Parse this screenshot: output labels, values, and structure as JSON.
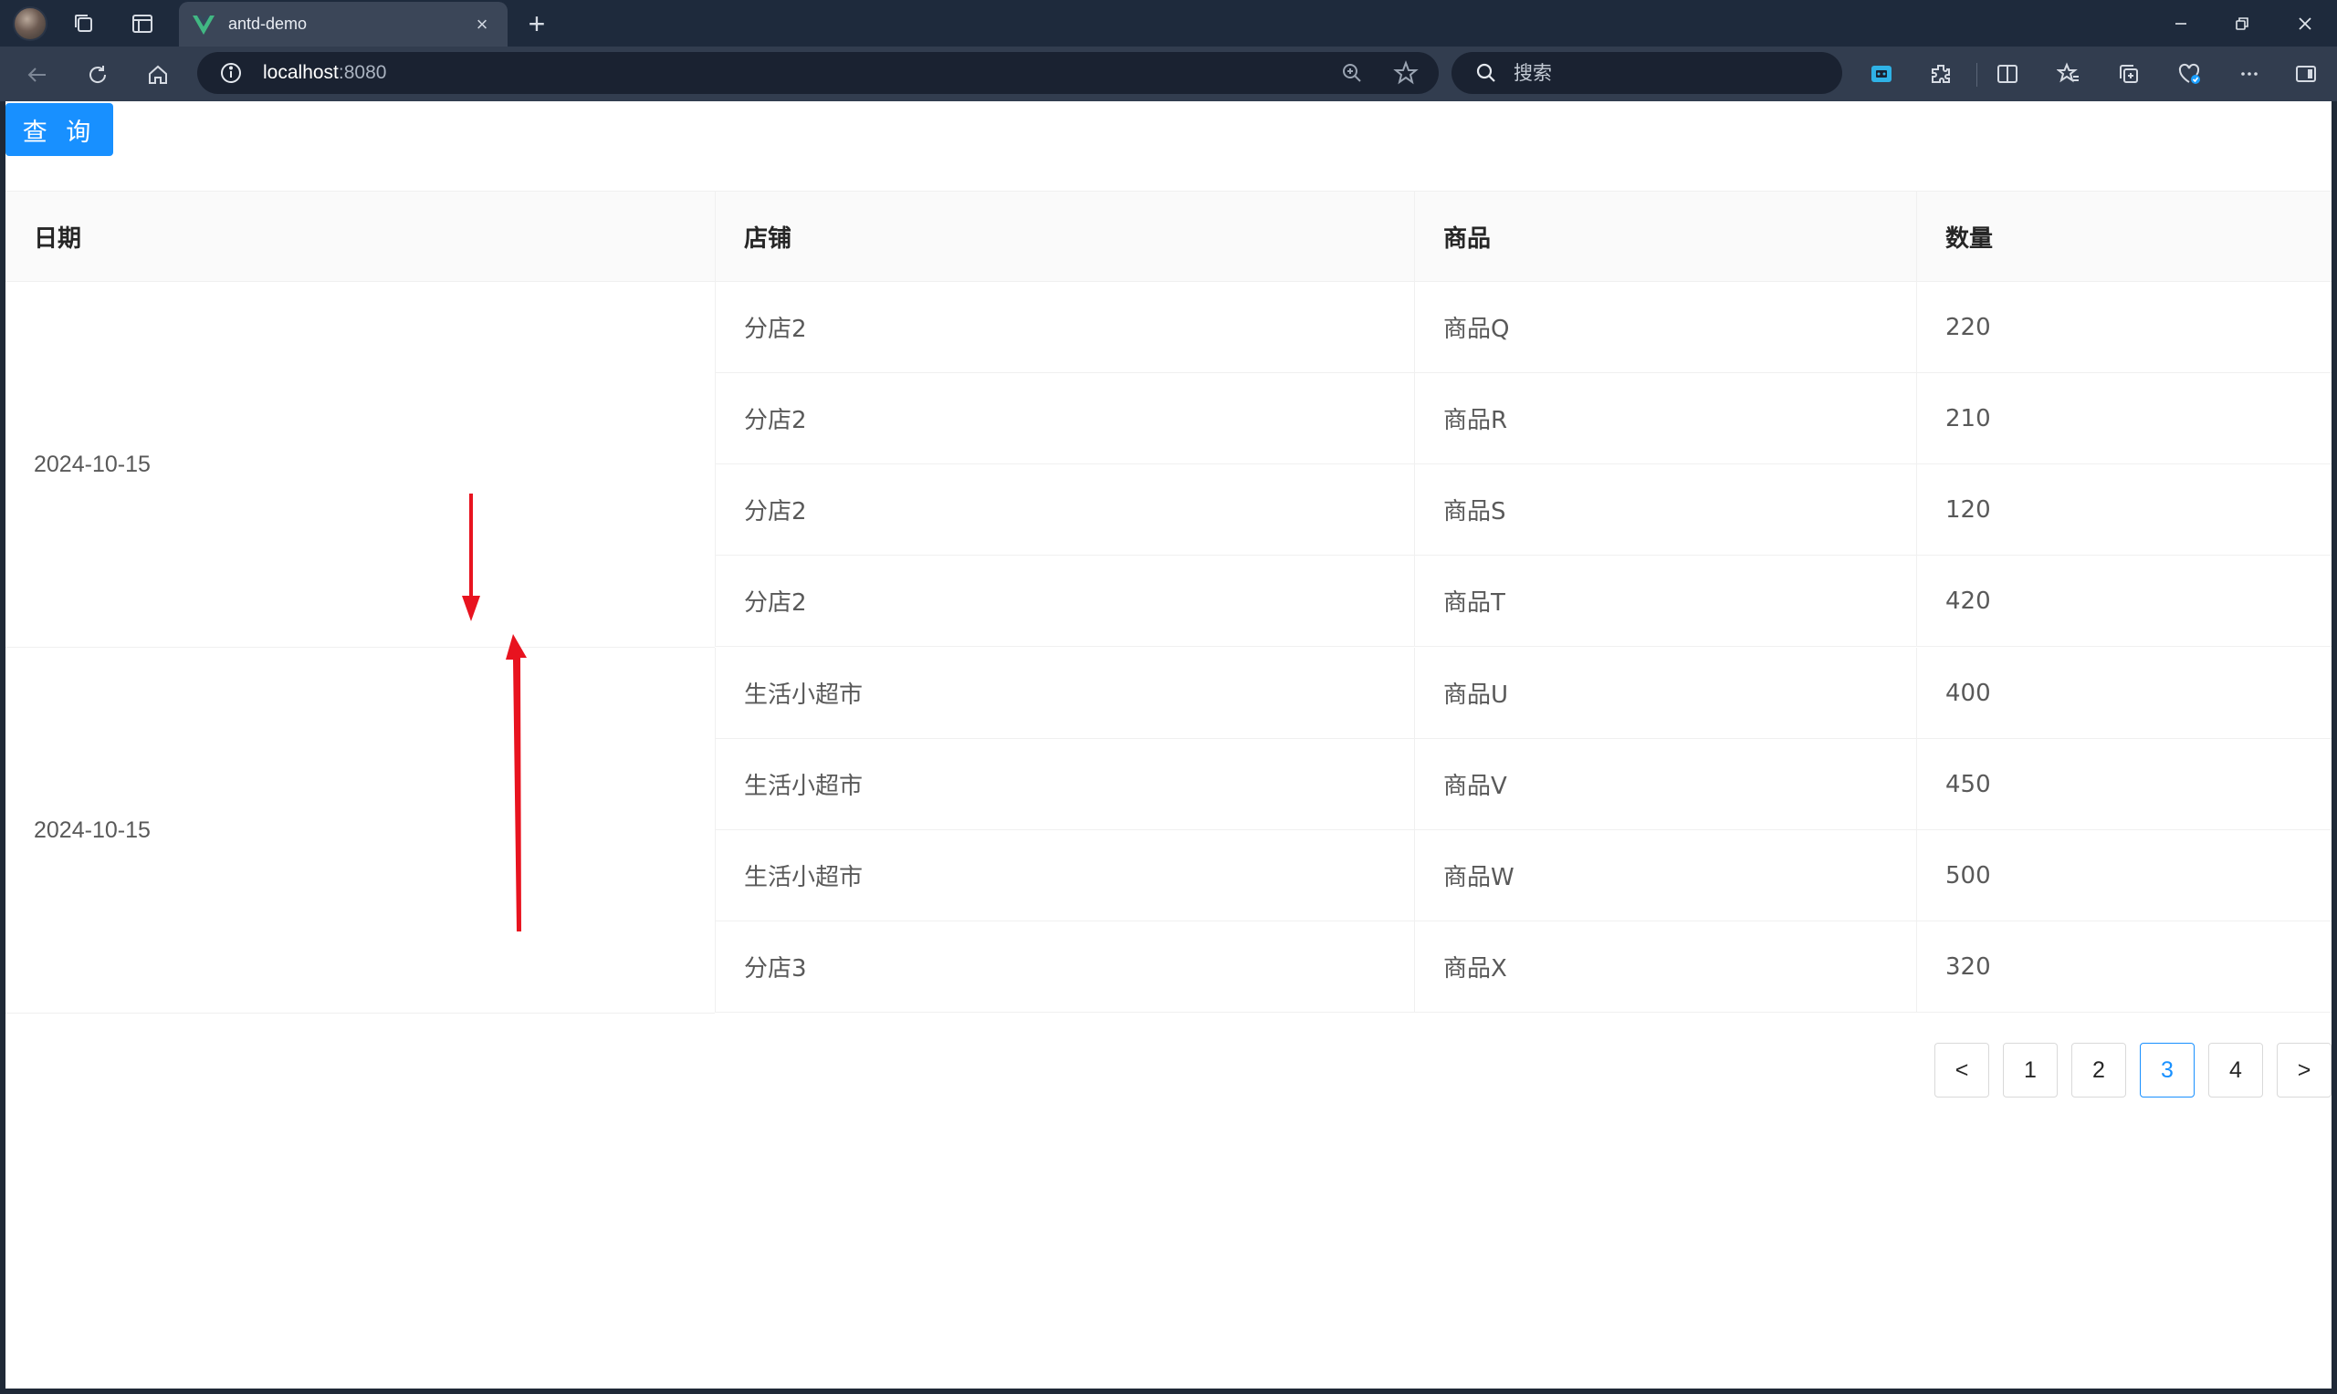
{
  "browser": {
    "tab_title": "antd-demo",
    "url_host": "localhost",
    "url_port": ":8080",
    "search_placeholder": "搜索",
    "new_tab_symbol": "+",
    "tab_close_symbol": "×"
  },
  "page": {
    "query_button": "查 询",
    "table": {
      "columns": [
        "日期",
        "店铺",
        "商品",
        "数量"
      ],
      "groups": [
        {
          "date": "2024-10-15"
        },
        {
          "date": "2024-10-15"
        }
      ],
      "rows": [
        {
          "shop": "分店2",
          "product": "商品Q",
          "qty": "220"
        },
        {
          "shop": "分店2",
          "product": "商品R",
          "qty": "210"
        },
        {
          "shop": "分店2",
          "product": "商品S",
          "qty": "120"
        },
        {
          "shop": "分店2",
          "product": "商品T",
          "qty": "420"
        },
        {
          "shop": "生活小超市",
          "product": "商品U",
          "qty": "400"
        },
        {
          "shop": "生活小超市",
          "product": "商品V",
          "qty": "450"
        },
        {
          "shop": "生活小超市",
          "product": "商品W",
          "qty": "500"
        },
        {
          "shop": "分店3",
          "product": "商品X",
          "qty": "320"
        }
      ]
    },
    "pagination": {
      "prev": "<",
      "pages": [
        "1",
        "2",
        "3",
        "4"
      ],
      "current": "3",
      "next": ">"
    }
  },
  "colors": {
    "primary": "#1890ff",
    "annotation_arrow": "#e8131f",
    "header_bg": "#fafafa",
    "border": "#f0f0f0",
    "chrome_dark": "#1e2a3c"
  }
}
